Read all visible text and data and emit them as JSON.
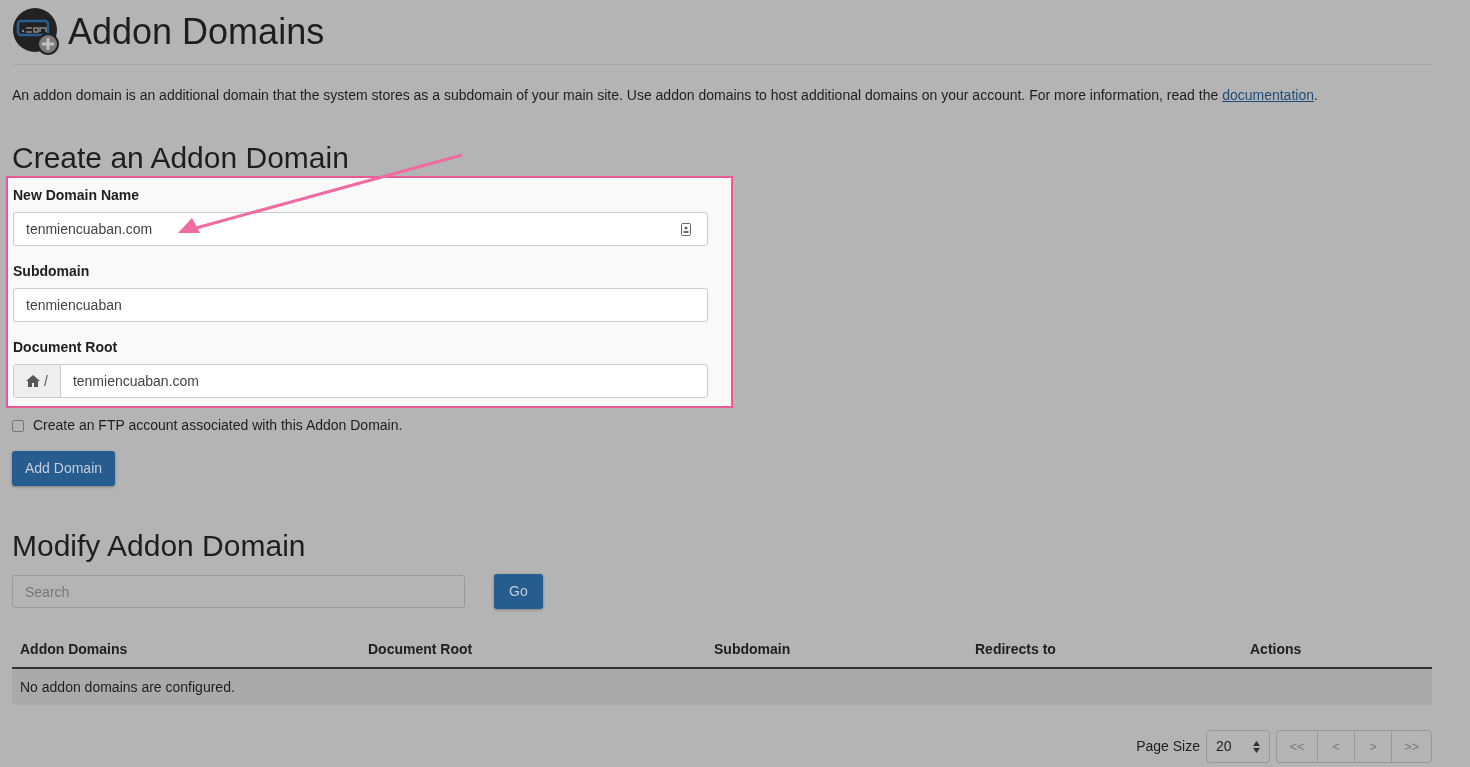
{
  "page": {
    "title": "Addon Domains",
    "description": "An addon domain is an additional domain that the system stores as a subdomain of your main site. Use addon domains to host additional domains on your account. For more information, read the ",
    "doc_link": "documentation",
    "description_end": "."
  },
  "create": {
    "heading": "Create an Addon Domain",
    "fields": [
      {
        "kind": "autofill",
        "label": "New Domain Name",
        "value": "tenmiencuaban.com"
      },
      {
        "kind": "plain",
        "label": "Subdomain",
        "value": "tenmiencuaban"
      },
      {
        "kind": "path",
        "label": "Document Root",
        "prefix": "/",
        "value": "tenmiencuaban.com"
      }
    ],
    "ftp_checkbox": {
      "label": "Create an FTP account associated with this Addon Domain.",
      "checked": false
    },
    "submit": "Add Domain"
  },
  "modify": {
    "heading": "Modify Addon Domain",
    "search": {
      "placeholder": "Search"
    },
    "go": "Go",
    "table": {
      "columns": [
        "Addon Domains",
        "Document Root",
        "Subdomain",
        "Redirects to",
        "Actions"
      ],
      "empty_message": "No addon domains are configured."
    },
    "page_size_label": "Page Size",
    "page_size": "20",
    "pager": [
      "<<",
      "<",
      ">",
      ">>"
    ]
  }
}
